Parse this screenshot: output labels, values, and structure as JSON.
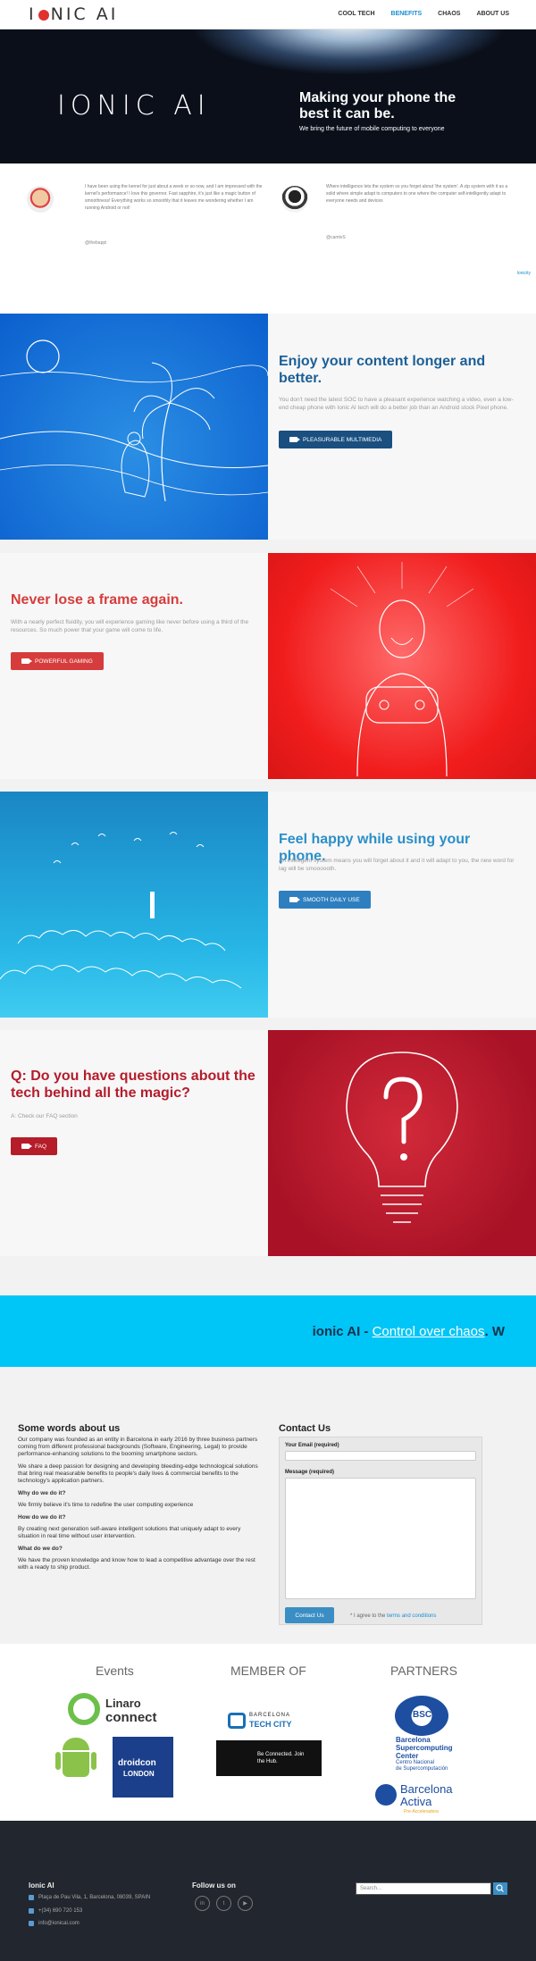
{
  "header": {
    "logo_left": "I",
    "logo_right": "NIC AI",
    "nav": [
      "COOL TECH",
      "BENEFITS",
      "CHAOS",
      "ABOUT US"
    ],
    "active_index": 1
  },
  "hero": {
    "logo": "IONIC AI",
    "title": "Making your phone the best it can be.",
    "subtitle": "We bring the future of mobile computing to everyone"
  },
  "testimonials": {
    "items": [
      {
        "quote": "I have been using the kernel for just about a week or so now, and I am impressed with the kernel's performance! I love this governor. Fast sapphire, it's just like a magic button of smoothness! Everything works so smoothly that it leaves me wondering whether I am running Android or not!",
        "handle": "@thebappi"
      },
      {
        "quote": "Where intelligence lets the system so you forget about 'the system'. A zip system with it as a solid where simple adapt to computers to one where the computer self-intelligently adapt to everyone needs and devices",
        "handle": "@camtvS"
      }
    ],
    "more": "Ionicity"
  },
  "features": [
    {
      "title": "Enjoy your content longer and better.",
      "desc": "You don't need the latest SOC to have a pleasant experience watching a video, even a low-end cheap phone with Ionic AI tech will do a better job than an Android stock Pixel phone.",
      "button": "PLEASURABLE MULTIMEDIA"
    },
    {
      "title": "Never lose a frame again.",
      "desc": "With a nearly perfect fluidity, you will experience gaming like never before using a third of the resources. So much power that your game will come to life.",
      "button": "POWERFUL GAMING"
    },
    {
      "title": "Feel happy while using your phone.",
      "desc": "An intelligent system means you will forget about it and it will adapt to you, the new word for lag will be smoooooth.",
      "button": "SMOOTH DAILY USE"
    },
    {
      "title": "Q: Do you have questions about the tech behind all the magic?",
      "desc": "A: Check our FAQ section",
      "button": "FAQ"
    }
  ],
  "banner": {
    "brand": "ionic AI - ",
    "link": "Control over chaos",
    "tail": ". W"
  },
  "about": {
    "heading": "Some words about us",
    "paragraphs": [
      "Our company was founded as an entity in Barcelona in early 2016 by three business partners coming from different professional backgrounds (Software, Engineering, Legal) to provide performance-enhancing solutions to the booming smartphone sectors.",
      "We share a deep passion for designing and developing bleeding-edge technological solutions that bring real measurable benefits to people's daily lives & commercial benefits to the technology's application partners."
    ],
    "qa": [
      {
        "q": "Why do we do it?",
        "a": "We firmly believe it's time to redefine the user computing experience"
      },
      {
        "q": "How do we do it?",
        "a": "By creating next generation self-aware intelligent solutions that uniquely adapt to every situation in real time without user intervention."
      },
      {
        "q": "What do we do?",
        "a": "We have the proven knowledge and know how to lead a competitive advantage over the rest with a ready to ship product."
      }
    ]
  },
  "contact": {
    "heading": "Contact Us",
    "email_label": "Your Email (required)",
    "message_label": "Message (required)",
    "submit": "Contact Us",
    "terms_prefix": "* I agree to the ",
    "terms_link": "terms and conditions"
  },
  "partners": {
    "events": "Events",
    "member": "MEMBER OF",
    "partners": "PARTNERS",
    "linaro_1": "Linaro",
    "linaro_2": "connect",
    "droidcon_1": "droidcon",
    "droidcon_2": "LONDON",
    "tech_city_1": "BARCELONA",
    "tech_city_2": "TECH CITY",
    "hub": "Be Connected. Join the Hub.",
    "bsc_logo": "BSC",
    "bsc_1": "Barcelona",
    "bsc_2": "Supercomputing",
    "bsc_3": "Center",
    "bsc_4": "Centro Nacional",
    "bsc_5": "de Supercomputación",
    "activa_1": "Barcelona",
    "activa_2": "Activa",
    "activa_3": "Pre-Acceleradora"
  },
  "footer": {
    "brand": "Ionic AI",
    "address": "Plaça de Pau Vila, 1, Barcelona, 08039, SPAIN",
    "phone": "+(34) 690 720 153",
    "email": "info@ionicai.com",
    "follow": "Follow us on",
    "search_placeholder": "Search..."
  },
  "colors": {
    "accent_blue": "#1b8dd1",
    "dark_blue_btn": "#1a4f80",
    "red": "#d63c3c",
    "cyan": "#00c5f7",
    "title_blue": "#1b5f97",
    "footer_bg": "#22262e"
  }
}
